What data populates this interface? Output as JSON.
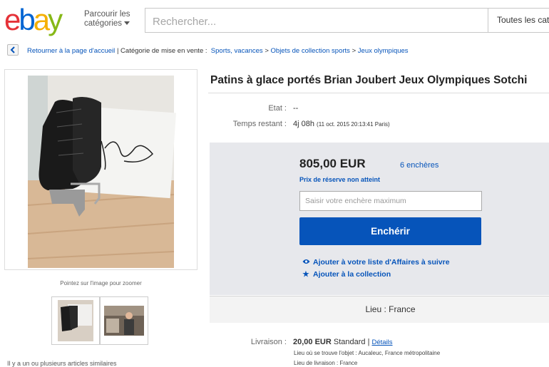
{
  "header": {
    "logo_letters": [
      "e",
      "b",
      "a",
      "y"
    ],
    "logo_colors": [
      "#e53238",
      "#0064d2",
      "#f5af02",
      "#86b817"
    ],
    "browse_line1": "Parcourir les",
    "browse_line2": "catégories",
    "search_placeholder": "Rechercher...",
    "category_select": "Toutes les caté"
  },
  "breadcrumb": {
    "back_label": "Retourner à la page d'accueil",
    "separator": "|",
    "category_prefix": "Catégorie de mise en vente :",
    "items": [
      "Sports, vacances",
      "Objets de collection sports",
      "Jeux olympiques"
    ],
    "arrow": ">"
  },
  "gallery": {
    "zoom_hint": "Pointez sur l'image pour zoomer",
    "bottom_note": "Il y a un ou plusieurs articles similaires"
  },
  "listing": {
    "title": "Patins à glace portés Brian Joubert Jeux Olympiques Sotchi",
    "etat_label": "Etat :",
    "etat_value": "--",
    "time_label": "Temps restant :",
    "time_value": "4j 08h",
    "time_detail": "(11 oct. 2015  20:13:41 Paris)"
  },
  "bid": {
    "price": "805,00 EUR",
    "bids_count": "6 enchères",
    "reserve": "Prix de réserve non atteint",
    "input_placeholder": "Saisir votre enchère maximum",
    "button": "Enchérir",
    "watch": "Ajouter à votre liste d'Affaires à suivre",
    "collection": "Ajouter à la collection",
    "location": "Lieu : France"
  },
  "shipping": {
    "label": "Livraison :",
    "price": "20,00 EUR",
    "method": "Standard |",
    "details": "Détails",
    "item_location": "Lieu où se trouve l'objet : Aucaleuc, France métropolitaine",
    "delivery_to": "Lieu de livraison : France"
  },
  "colors": {
    "link": "#0654ba",
    "button": "#0654ba",
    "panel": "#e7e8ec"
  }
}
